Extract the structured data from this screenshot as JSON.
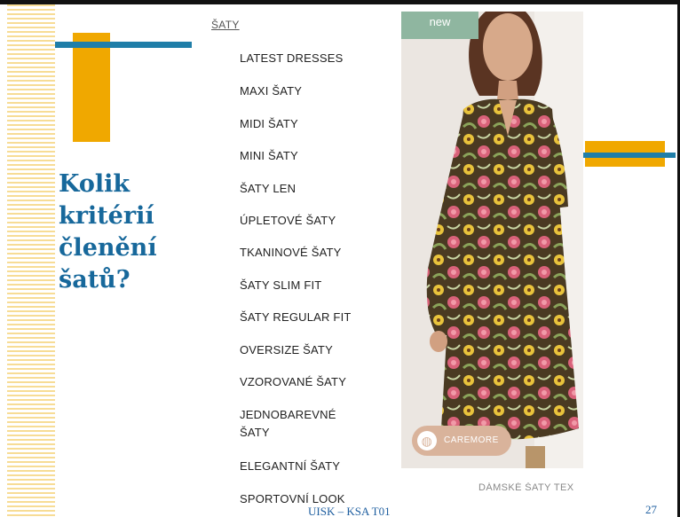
{
  "slide": {
    "title_lines": [
      "Kolik",
      "kritérií",
      "členění",
      "šatů?"
    ],
    "footer": "UISK – KSA T01",
    "page_number": "27"
  },
  "website": {
    "breadcrumb": "ŠATY",
    "menu": [
      "LATEST DRESSES",
      "MAXI ŠATY",
      "MIDI ŠATY",
      "MINI ŠATY",
      "ŠATY LEN",
      "ÚPLETOVÉ ŠATY",
      "TKANINOVÉ ŠATY",
      "ŠATY SLIM FIT",
      "ŠATY REGULAR FIT",
      "OVERSIZE ŠATY",
      "VZOROVANÉ ŠATY",
      "JEDNOBAREVNÉ ŠATY",
      "ELEGANTNÍ ŠATY",
      "SPORTOVNÍ LOOK"
    ],
    "product": {
      "badge": "new",
      "brand": "CAREMORE",
      "caption": "DÁMSKÉ ŠATY TEX"
    }
  },
  "colors": {
    "accent_gold": "#f0a800",
    "accent_blue": "#1f7ea8",
    "title_blue": "#17689b",
    "stripe_yellow": "#f7dc95"
  }
}
